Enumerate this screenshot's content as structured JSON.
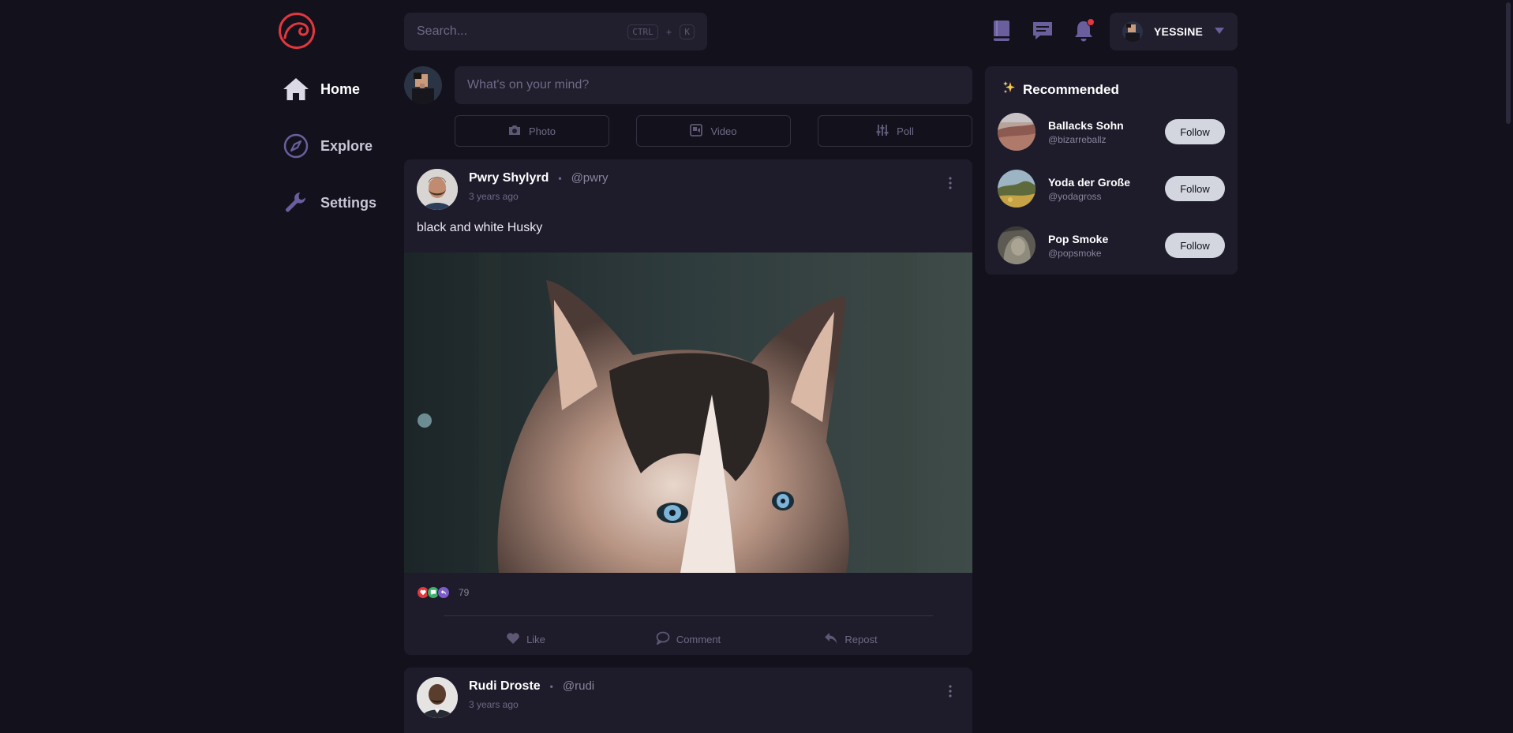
{
  "sidebar": {
    "items": [
      {
        "label": "Home"
      },
      {
        "label": "Explore"
      },
      {
        "label": "Settings"
      }
    ]
  },
  "search": {
    "placeholder": "Search...",
    "shortcut_mod": "CTRL",
    "shortcut_plus": "+",
    "shortcut_key": "K"
  },
  "user": {
    "name": "YESSINE"
  },
  "composer": {
    "placeholder": "What's on your mind?",
    "actions": [
      {
        "label": "Photo"
      },
      {
        "label": "Video"
      },
      {
        "label": "Poll"
      }
    ]
  },
  "posts": [
    {
      "name": "Pwry Shylyrd",
      "handle": "@pwry",
      "time": "3 years ago",
      "text": "black and white Husky",
      "reaction_count": "79",
      "actions": {
        "like": "Like",
        "comment": "Comment",
        "repost": "Repost"
      }
    },
    {
      "name": "Rudi Droste",
      "handle": "@rudi",
      "time": "3 years ago"
    }
  ],
  "recommended": {
    "title": "Recommended",
    "follow_label": "Follow",
    "users": [
      {
        "name": "Ballacks Sohn",
        "handle": "@bizarreballz"
      },
      {
        "name": "Yoda der Große",
        "handle": "@yodagross"
      },
      {
        "name": "Pop Smoke",
        "handle": "@popsmoke"
      }
    ]
  },
  "colors": {
    "background": "#13111c",
    "card": "#1e1b2b",
    "accent": "#e0383e",
    "icon_purple": "#6a5f9c"
  },
  "icons": [
    "logo-wave-icon",
    "home-icon",
    "compass-icon",
    "wrench-icon",
    "book-icon",
    "chat-icon",
    "bell-icon",
    "caret-down-icon",
    "camera-icon",
    "video-icon",
    "sliders-icon",
    "more-vertical-icon",
    "heart-icon",
    "comment-icon",
    "repost-icon",
    "sparkles-icon"
  ]
}
